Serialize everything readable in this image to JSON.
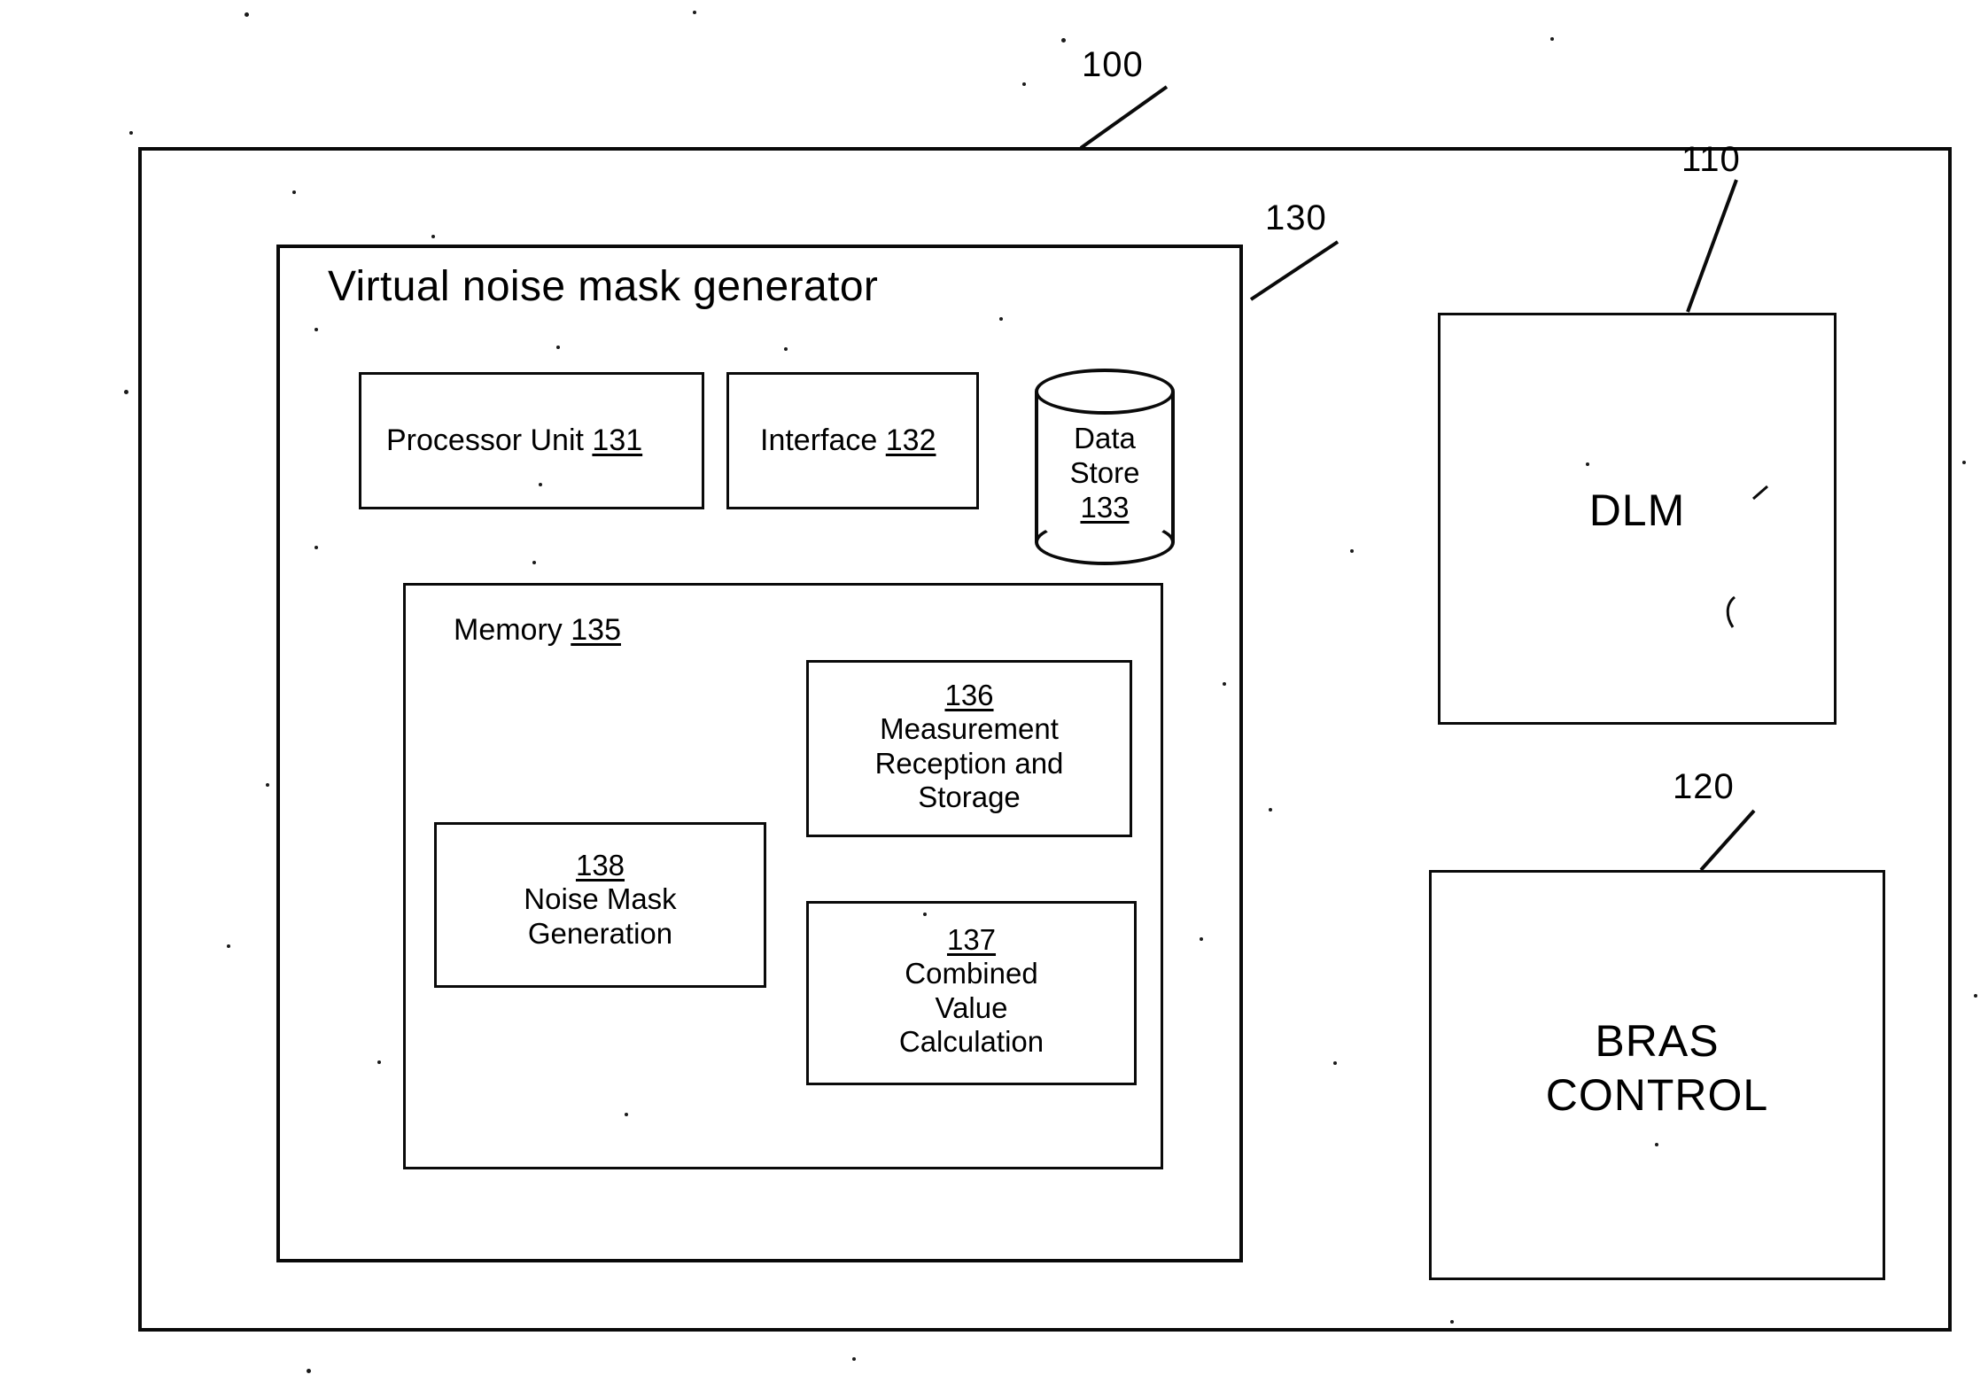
{
  "figure": {
    "refs": {
      "system": "100",
      "generator": "130",
      "dlm": "110",
      "bras": "120"
    }
  },
  "generator": {
    "title": "Virtual noise mask generator",
    "processor_unit": {
      "label": "Processor Unit",
      "ref": "131"
    },
    "interface": {
      "label": "Interface",
      "ref": "132"
    },
    "data_store": {
      "line1": "Data",
      "line2": "Store",
      "ref": "133"
    },
    "memory": {
      "label": "Memory",
      "ref": "135",
      "modules": [
        {
          "ref": "136",
          "lines": [
            "Measurement",
            "Reception and",
            "Storage"
          ]
        },
        {
          "ref": "138",
          "lines": [
            "Noise Mask",
            "Generation"
          ]
        },
        {
          "ref": "137",
          "lines": [
            "Combined",
            "Value",
            "Calculation"
          ]
        }
      ]
    }
  },
  "dlm": {
    "label": "DLM"
  },
  "bras": {
    "line1": "BRAS",
    "line2": "CONTROL"
  }
}
